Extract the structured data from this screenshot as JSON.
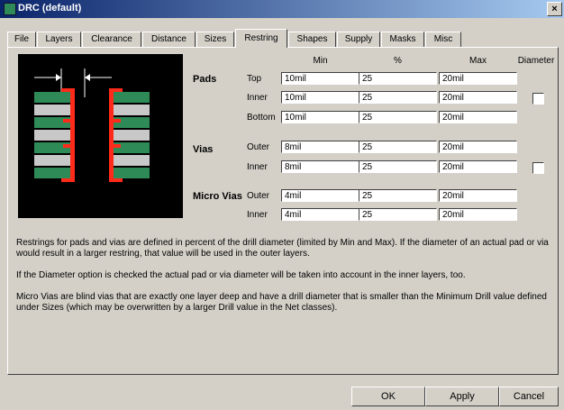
{
  "window": {
    "title": "DRC (default)",
    "close": "×"
  },
  "tabs": [
    "File",
    "Layers",
    "Clearance",
    "Distance",
    "Sizes",
    "Restring",
    "Shapes",
    "Supply",
    "Masks",
    "Misc"
  ],
  "active_tab": "Restring",
  "headers": {
    "min": "Min",
    "pct": "%",
    "max": "Max",
    "diameter": "Diameter"
  },
  "groups": {
    "pads": {
      "label": "Pads",
      "rows": [
        {
          "label": "Top",
          "min": "10mil",
          "pct": "25",
          "max": "20mil"
        },
        {
          "label": "Inner",
          "min": "10mil",
          "pct": "25",
          "max": "20mil"
        },
        {
          "label": "Bottom",
          "min": "10mil",
          "pct": "25",
          "max": "20mil"
        }
      ],
      "diameter_checked": false
    },
    "vias": {
      "label": "Vias",
      "rows": [
        {
          "label": "Outer",
          "min": "8mil",
          "pct": "25",
          "max": "20mil"
        },
        {
          "label": "Inner",
          "min": "8mil",
          "pct": "25",
          "max": "20mil"
        }
      ],
      "diameter_checked": false
    },
    "micro_vias": {
      "label": "Micro Vias",
      "rows": [
        {
          "label": "Outer",
          "min": "4mil",
          "pct": "25",
          "max": "20mil"
        },
        {
          "label": "Inner",
          "min": "4mil",
          "pct": "25",
          "max": "20mil"
        }
      ]
    }
  },
  "description": {
    "p1": "Restrings for pads and vias are defined in percent of the drill diameter (limited by Min and Max). If the diameter of an actual pad or via would result in a larger restring, that value will be used in the outer layers.",
    "p2": "If the Diameter option is checked the actual pad or via diameter will be taken into account in the inner layers, too.",
    "p3": "Micro Vias are blind vias that are exactly one layer deep and have a drill diameter that is smaller than the Minimum Drill value defined under Sizes (which may be overwritten by a larger Drill value in the Net classes)."
  },
  "buttons": {
    "ok": "OK",
    "apply": "Apply",
    "cancel": "Cancel"
  },
  "colors": {
    "titlebar": "#0a246a",
    "pad_green": "#2e8b57",
    "copper_red": "#ff2a1a",
    "pad_grey": "#c8c8c8"
  }
}
